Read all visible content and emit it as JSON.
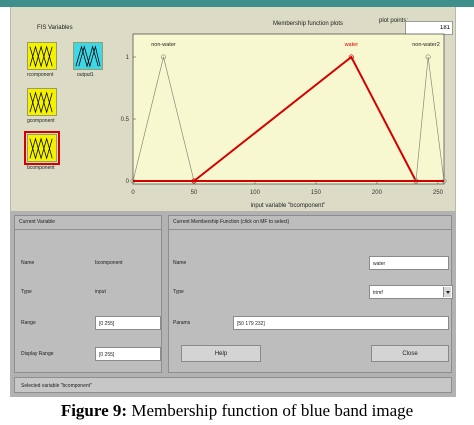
{
  "fis_variables": {
    "title": "FIS Variables",
    "items": [
      {
        "label": "rcomponent",
        "kind": "input",
        "selected": false
      },
      {
        "label": "output1",
        "kind": "output",
        "selected": false
      },
      {
        "label": "gcomponent",
        "kind": "input",
        "selected": false
      },
      {
        "label": "bcomponent",
        "kind": "input",
        "selected": true
      }
    ]
  },
  "plot": {
    "title": "Membership function plots",
    "plot_points_label": "plot points:",
    "plot_points_value": "181"
  },
  "chart_data": {
    "type": "line",
    "xlabel": "input variable \"bcomponent\"",
    "xlim": [
      0,
      255
    ],
    "ylim": [
      0,
      1
    ],
    "xticks": [
      "0",
      "50",
      "100",
      "150",
      "200",
      "250"
    ],
    "yticks": [
      "0",
      "0.5",
      "1"
    ],
    "series": [
      {
        "name": "non-water",
        "type": "trimf",
        "params": [
          0,
          25,
          50
        ],
        "selected": false,
        "color": "#8a8a7a"
      },
      {
        "name": "water",
        "type": "trimf",
        "params": [
          50,
          179,
          232
        ],
        "selected": true,
        "color": "#d40000"
      },
      {
        "name": "non-water2",
        "type": "trimf",
        "params": [
          232,
          242,
          255
        ],
        "selected": false,
        "color": "#8a8a7a"
      }
    ]
  },
  "current_variable": {
    "header": "Current Variable",
    "name_label": "Name",
    "name_value": "bcomponent",
    "type_label": "Type",
    "type_value": "input",
    "range_label": "Range",
    "range_value": "[0 255]",
    "display_range_label": "Display Range",
    "display_range_value": "[0 255]"
  },
  "current_mf": {
    "header": "Current Membership Function (click on MF to select)",
    "name_label": "Name",
    "name_value": "water",
    "type_label": "Type",
    "type_value": "trimf",
    "params_label": "Params",
    "params_value": "[50 179 232]"
  },
  "buttons": {
    "help": "Help",
    "close": "Close"
  },
  "status": "Selected variable \"bcomponent\"",
  "caption": {
    "bold": "Figure 9:",
    "text": " Membership function of blue band image"
  }
}
